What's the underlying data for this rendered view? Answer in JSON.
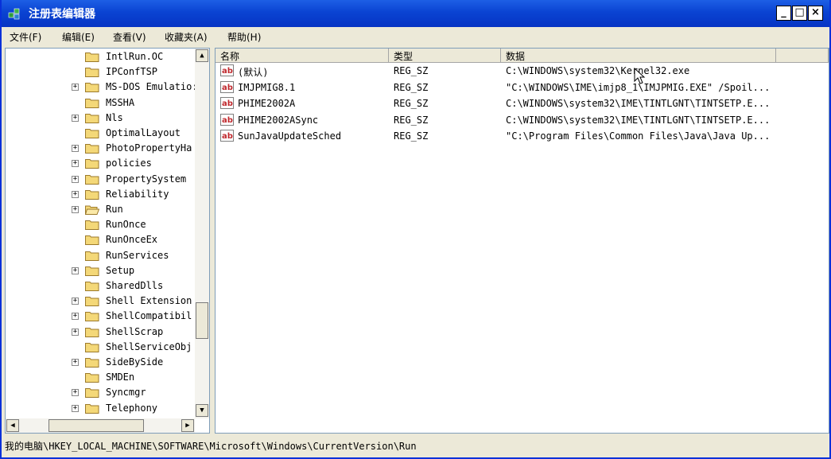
{
  "window": {
    "title": "注册表编辑器",
    "minimize_label": "_",
    "maximize_label": "□",
    "close_label": "×"
  },
  "menu": [
    "文件(F)",
    "编辑(E)",
    "查看(V)",
    "收藏夹(A)",
    "帮助(H)"
  ],
  "tree": {
    "items": [
      {
        "label": "IntlRun.OC",
        "expander": false
      },
      {
        "label": "IPConfTSP",
        "expander": false
      },
      {
        "label": "MS-DOS Emulatio:",
        "expander": true
      },
      {
        "label": "MSSHA",
        "expander": false
      },
      {
        "label": "Nls",
        "expander": true
      },
      {
        "label": "OptimalLayout",
        "expander": false
      },
      {
        "label": "PhotoPropertyHa",
        "expander": true
      },
      {
        "label": "policies",
        "expander": true
      },
      {
        "label": "PropertySystem",
        "expander": true
      },
      {
        "label": "Reliability",
        "expander": true
      },
      {
        "label": "Run",
        "expander": true,
        "open": true
      },
      {
        "label": "RunOnce",
        "expander": false
      },
      {
        "label": "RunOnceEx",
        "expander": false
      },
      {
        "label": "RunServices",
        "expander": false
      },
      {
        "label": "Setup",
        "expander": true
      },
      {
        "label": "SharedDlls",
        "expander": false
      },
      {
        "label": "Shell Extension",
        "expander": true
      },
      {
        "label": "ShellCompatibil",
        "expander": true
      },
      {
        "label": "ShellScrap",
        "expander": true
      },
      {
        "label": "ShellServiceObj",
        "expander": false
      },
      {
        "label": "SideBySide",
        "expander": true
      },
      {
        "label": "SMDEn",
        "expander": false
      },
      {
        "label": "Syncmgr",
        "expander": true
      },
      {
        "label": "Telephony",
        "expander": true
      }
    ],
    "expander_plus": "+"
  },
  "list": {
    "columns": [
      "名称",
      "类型",
      "数据"
    ],
    "rows": [
      {
        "name": "(默认)",
        "type": "REG_SZ",
        "data": "C:\\WINDOWS\\system32\\Kernel32.exe"
      },
      {
        "name": "IMJPMIG8.1",
        "type": "REG_SZ",
        "data": "\"C:\\WINDOWS\\IME\\imjp8_1\\IMJPMIG.EXE\" /Spoil..."
      },
      {
        "name": "PHIME2002A",
        "type": "REG_SZ",
        "data": "C:\\WINDOWS\\system32\\IME\\TINTLGNT\\TINTSETP.E..."
      },
      {
        "name": "PHIME2002ASync",
        "type": "REG_SZ",
        "data": "C:\\WINDOWS\\system32\\IME\\TINTLGNT\\TINTSETP.E..."
      },
      {
        "name": "SunJavaUpdateSched",
        "type": "REG_SZ",
        "data": "\"C:\\Program Files\\Common Files\\Java\\Java Up..."
      }
    ]
  },
  "status": {
    "path": "我的电脑\\HKEY_LOCAL_MACHINE\\SOFTWARE\\Microsoft\\Windows\\CurrentVersion\\Run"
  },
  "colors": {
    "titlebar": "#0a43d2",
    "folder": "#f4d878",
    "reg_icon": "#c0282d"
  }
}
